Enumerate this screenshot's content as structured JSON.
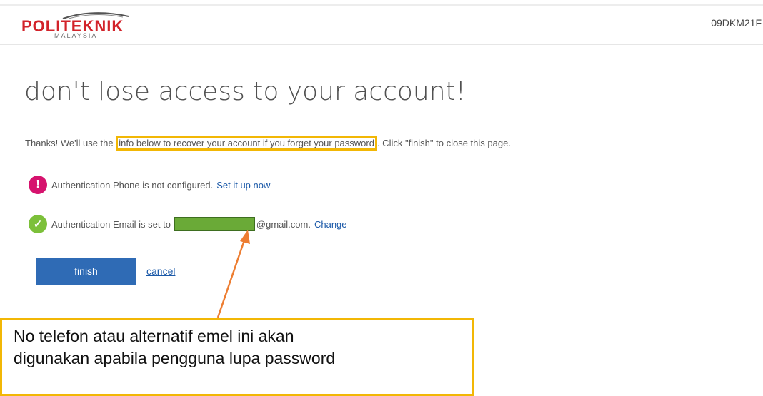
{
  "header": {
    "logo_text": "POLITEKNIK",
    "logo_sub": "MALAYSIA",
    "user_id": "09DKM21F"
  },
  "main": {
    "title": "don't lose access to your account!",
    "intro_before": "Thanks! We'll use the",
    "intro_highlight": "info below to recover your account if you forget your password",
    "intro_after": ". Click \"finish\" to close this page.",
    "phone": {
      "text": "Authentication Phone is not configured.",
      "link": "Set it up now"
    },
    "email": {
      "text": "Authentication Email is set to",
      "domain": "@gmail.com.",
      "link": "Change"
    },
    "finish_label": "finish",
    "cancel_label": "cancel"
  },
  "callout": {
    "line1": "No telefon atau alternatif emel ini akan",
    "line2": "digunakan apabila pengguna lupa password"
  },
  "icons": {
    "warning": "exclamation-circle-icon",
    "success": "check-circle-icon"
  },
  "colors": {
    "accent": "#2f6bb5",
    "highlight": "#f2b705",
    "warning": "#d6136e",
    "success": "#7cc03a",
    "redaction": "#6aaa37",
    "arrow": "#ed7d31"
  }
}
